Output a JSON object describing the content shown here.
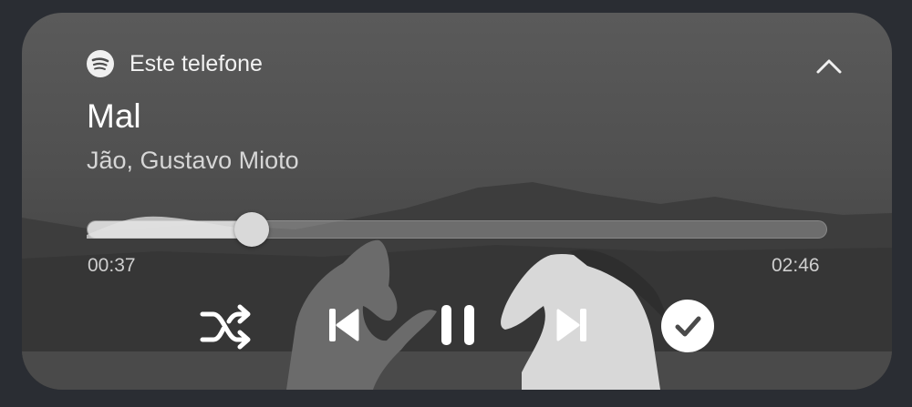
{
  "header": {
    "source_label": "Este telefone",
    "app_icon": "spotify-icon",
    "collapse_icon": "chevron-up-icon"
  },
  "track": {
    "title": "Mal",
    "artist": "Jão, Gustavo Mioto"
  },
  "progress": {
    "elapsed": "00:37",
    "duration": "02:46",
    "fraction": 0.223
  },
  "controls": {
    "shuffle_icon": "shuffle-icon",
    "previous_icon": "skip-previous-icon",
    "play_pause_icon": "pause-icon",
    "next_icon": "skip-next-icon",
    "saved_icon": "check-circle-icon"
  },
  "colors": {
    "text_primary": "#ffffff",
    "text_secondary": "#d6d6d6",
    "accent": "#ffffff"
  }
}
